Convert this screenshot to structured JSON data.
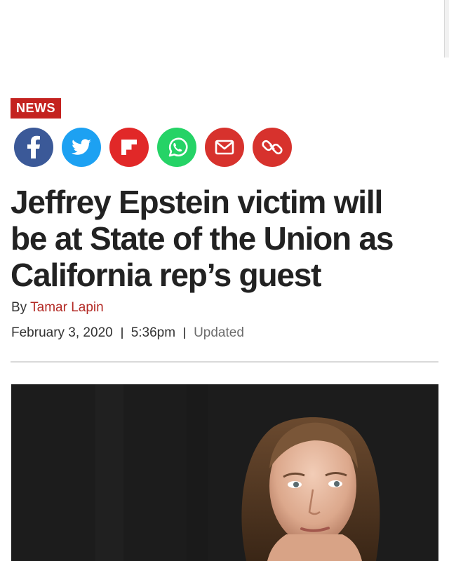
{
  "section_badge": "NEWS",
  "share": {
    "buttons": [
      {
        "icon": "facebook-icon",
        "color": "#3b5998"
      },
      {
        "icon": "twitter-icon",
        "color": "#1da1f2"
      },
      {
        "icon": "flipboard-icon",
        "color": "#e12828"
      },
      {
        "icon": "whatsapp-icon",
        "color": "#25d366"
      },
      {
        "icon": "email-icon",
        "color": "#d7322d"
      },
      {
        "icon": "link-icon",
        "color": "#d7322d"
      }
    ]
  },
  "article": {
    "headline_lines": [
      "Jeffrey Epstein victim will",
      "be at State of the Union as",
      "California rep’s guest"
    ],
    "byline_prefix": "By",
    "author": "Tamar Lapin",
    "date": "February 3, 2020",
    "time": "5:36pm",
    "updated_label": "Updated"
  },
  "photo": {
    "subject": "woman-portrait"
  },
  "colors": {
    "accent": "#c4221f",
    "author_link": "#b32a25"
  }
}
